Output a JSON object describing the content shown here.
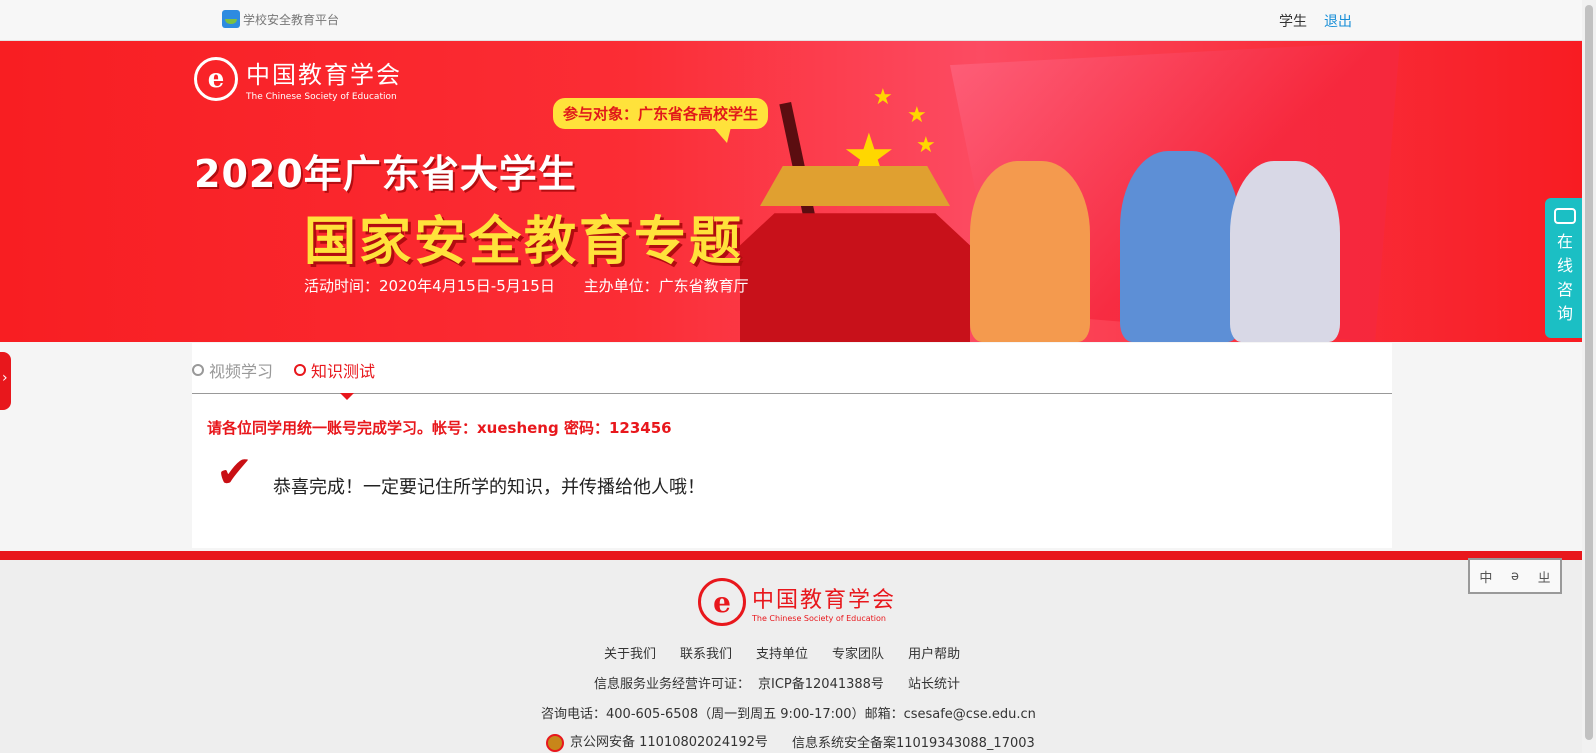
{
  "topbar": {
    "site_name": "学校安全教育平台",
    "user": "学生",
    "logout": "退出"
  },
  "banner": {
    "org_cn": "中国教育学会",
    "org_en": "The Chinese Society of Education",
    "bubble": "参与对象：广东省各高校学生",
    "title1": "2020年广东省大学生",
    "title2": "国家安全教育专题",
    "activity_time": "活动时间：2020年4月15日-5月15日",
    "organizer": "主办单位：广东省教育厅"
  },
  "chat": {
    "label": "在线咨询"
  },
  "tabs": [
    {
      "label": "视频学习"
    },
    {
      "label": "知识测试"
    }
  ],
  "main": {
    "notice": "请各位同学用统一账号完成学习。帐号：xuesheng 密码：123456",
    "done": "恭喜完成！一定要记住所学的知识，并传播给他人哦！"
  },
  "footer": {
    "org_cn": "中国教育学会",
    "org_en": "The Chinese Society of Education",
    "links": [
      "关于我们",
      "联系我们",
      "支持单位",
      "专家团队",
      "用户帮助"
    ],
    "icp_label": "信息服务业务经营许可证：",
    "icp": "京ICP备12041388号",
    "stats": "站长统计",
    "contact": "咨询电话：400-605-6508（周一到周五 9:00-17:00）邮箱：csesafe@cse.edu.cn",
    "police": "京公网安备 11010802024192号",
    "security": "信息系统安全备案11019343088_17003"
  },
  "lang": {
    "zh": "中",
    "a": "ə",
    "b": "ㄓ"
  },
  "colors": {
    "brand_red": "#e8171c",
    "accent_yellow": "#ffe23b",
    "chat_teal": "#1bbfc4",
    "link_blue": "#1a8fd7"
  }
}
